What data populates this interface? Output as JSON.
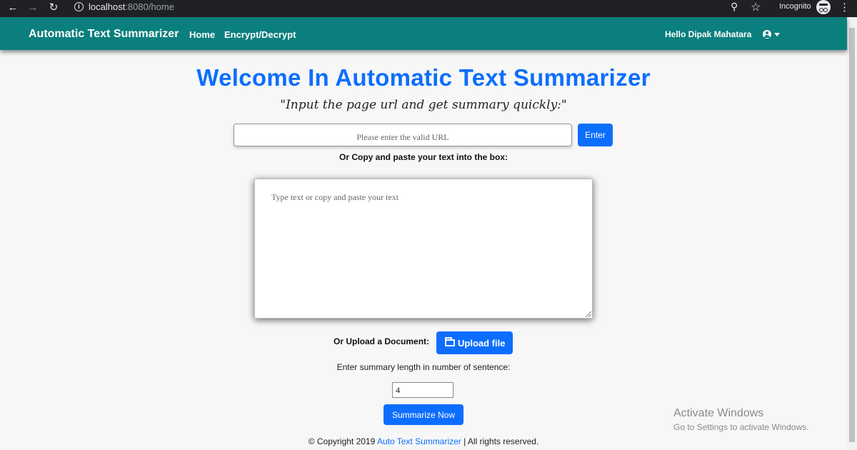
{
  "browser": {
    "url_host": "localhost",
    "url_path": ":8080/home",
    "incognito_label": "Incognito"
  },
  "navbar": {
    "brand": "Automatic Text Summarizer",
    "links": [
      "Home",
      "Encrypt/Decrypt"
    ],
    "greeting": "Hello Dipak Mahatara",
    "bg_color": "#0a7f7d"
  },
  "main": {
    "title": "Welcome In Automatic Text Summarizer",
    "subtitle": "\"Input the page url and get summary quickly:\"",
    "url_placeholder": "Please enter the valid URL",
    "enter_label": "Enter",
    "paste_label": "Or Copy and paste your text into the box:",
    "text_placeholder": "Type text or copy and paste your text",
    "upload_label": "Or Upload a Document:",
    "upload_button": "Upload file",
    "length_label": "Enter summary length in number of sentence:",
    "length_value": "4",
    "summarize_button": "Summarize Now",
    "accent_color": "#0d6efd"
  },
  "footer": {
    "prefix": "© Copyright 2019 ",
    "link": "Auto Text Summarizer",
    "suffix": " | All rights reserved."
  },
  "watermark": {
    "title": "Activate Windows",
    "subtitle": "Go to Settings to activate Windows."
  }
}
